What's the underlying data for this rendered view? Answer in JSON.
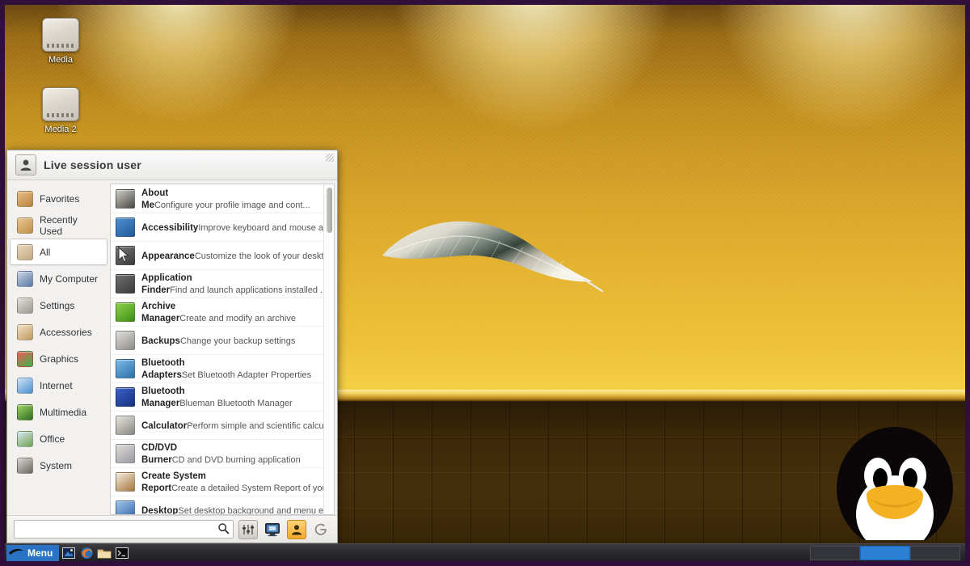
{
  "desktop": {
    "icons": [
      {
        "label": "Media",
        "icon": "drive-harddisk-icon"
      },
      {
        "label": "Media 2",
        "icon": "drive-harddisk-icon"
      }
    ],
    "wallpaper": {
      "description": "feather on golden wall",
      "wall_color": "#d7a52c",
      "floor_color": "#3c2809"
    },
    "tux": "tux-penguin-graphic"
  },
  "menu": {
    "user": "Live session user",
    "avatar_icon": "user-avatar-icon",
    "categories": [
      {
        "label": "Favorites",
        "icon": "favorites-icon",
        "selected": false,
        "color1": "#e8c089",
        "color2": "#b8823c"
      },
      {
        "label": "Recently Used",
        "icon": "recent-icon",
        "selected": false,
        "color1": "#e9c795",
        "color2": "#c08f46"
      },
      {
        "label": "All",
        "icon": "all-applications-icon",
        "selected": true,
        "color1": "#ead9bd",
        "color2": "#c2a87e"
      },
      {
        "label": "My Computer",
        "icon": "computer-icon",
        "selected": false,
        "color1": "#cfd7e3",
        "color2": "#5878a8"
      },
      {
        "label": "Settings",
        "icon": "settings-icon",
        "selected": false,
        "color1": "#e3e1dc",
        "color2": "#9a978f"
      },
      {
        "label": "Accessories",
        "icon": "accessories-icon",
        "selected": false,
        "color1": "#f0e2c8",
        "color2": "#c09a5c"
      },
      {
        "label": "Graphics",
        "icon": "graphics-icon",
        "selected": false,
        "color1": "#f05a5a",
        "color2": "#3ab54a"
      },
      {
        "label": "Internet",
        "icon": "internet-icon",
        "selected": false,
        "color1": "#cfe2f5",
        "color2": "#4a8fd0"
      },
      {
        "label": "Multimedia",
        "icon": "multimedia-icon",
        "selected": false,
        "color1": "#9fd86a",
        "color2": "#2e6b20"
      },
      {
        "label": "Office",
        "icon": "office-icon",
        "selected": false,
        "color1": "#d8e8f5",
        "color2": "#6fa24d"
      },
      {
        "label": "System",
        "icon": "system-icon",
        "selected": false,
        "color1": "#d8d6d2",
        "color2": "#6b6862"
      }
    ],
    "applications": [
      {
        "name": "About Me",
        "desc": "Configure your profile image and cont...",
        "icon": "about-me-icon",
        "color1": "#cfcdc8",
        "color2": "#4a4843"
      },
      {
        "name": "Accessibility",
        "desc": "Improve keyboard and mouse accessi...",
        "icon": "accessibility-icon",
        "color1": "#4f90d0",
        "color2": "#205a9a"
      },
      {
        "name": "Appearance",
        "desc": "Customize the look of your desktop",
        "icon": "appearance-icon",
        "color1": "#7a7a7a",
        "color2": "#3a3a3a"
      },
      {
        "name": "Application Finder",
        "desc": "Find and launch applications installed ...",
        "icon": "application-finder-icon",
        "color1": "#6e6e6e",
        "color2": "#3c3c3c"
      },
      {
        "name": "Archive Manager",
        "desc": "Create and modify an archive",
        "icon": "archive-manager-icon",
        "color1": "#8ed24a",
        "color2": "#3d8f18"
      },
      {
        "name": "Backups",
        "desc": "Change your backup settings",
        "icon": "backups-icon",
        "color1": "#e2e0dc",
        "color2": "#8e8c87"
      },
      {
        "name": "Bluetooth Adapters",
        "desc": "Set Bluetooth Adapter Properties",
        "icon": "bluetooth-adapters-icon",
        "color1": "#7fbce8",
        "color2": "#2a6fa8"
      },
      {
        "name": "Bluetooth Manager",
        "desc": "Blueman Bluetooth Manager",
        "icon": "bluetooth-manager-icon",
        "color1": "#3a62c8",
        "color2": "#16307e"
      },
      {
        "name": "Calculator",
        "desc": "Perform simple and scientific calculatio...",
        "icon": "calculator-icon",
        "color1": "#e6e4df",
        "color2": "#8a8882"
      },
      {
        "name": "CD/DVD Burner",
        "desc": "CD and DVD burning application",
        "icon": "cd-dvd-burner-icon",
        "color1": "#e0ddd8",
        "color2": "#9a98a4"
      },
      {
        "name": "Create System Report",
        "desc": "Create a detailed System Report of you...",
        "icon": "system-report-icon",
        "color1": "#f2ece0",
        "color2": "#a8763c"
      },
      {
        "name": "Desktop",
        "desc": "Set desktop background and menu en...",
        "icon": "desktop-icon",
        "color1": "#9fc4ea",
        "color2": "#2f64a8"
      }
    ],
    "search": {
      "value": "",
      "placeholder": ""
    },
    "search_icon": "search-icon",
    "footer_buttons": [
      {
        "icon": "settings-manager-icon",
        "title": "Settings Manager"
      },
      {
        "icon": "my-computer-icon",
        "title": "My Computer"
      },
      {
        "icon": "lock-screen-icon",
        "title": "Lock Screen"
      },
      {
        "icon": "log-out-icon",
        "title": "Log Out"
      }
    ]
  },
  "taskbar": {
    "menu_label": "Menu",
    "menu_icon": "xfce-mouse-icon",
    "launchers": [
      {
        "icon": "show-desktop-icon"
      },
      {
        "icon": "firefox-icon"
      },
      {
        "icon": "file-manager-icon"
      },
      {
        "icon": "terminal-icon"
      }
    ],
    "workspaces": [
      {
        "active": false
      },
      {
        "active": true
      },
      {
        "active": false
      }
    ]
  },
  "colors": {
    "accent": "#2a72c4",
    "panel_bg": "#f2f1f0",
    "border": "#30103a"
  }
}
